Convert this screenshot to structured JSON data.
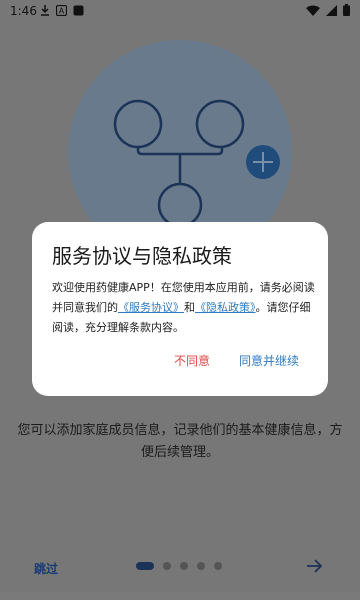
{
  "status": {
    "time": "1:46"
  },
  "onboarding": {
    "description": "您可以添加家庭成员信息，记录他们的基本健康信息，方便后续管理。",
    "skip_label": "跳过",
    "page_count": 5,
    "active_page": 1
  },
  "dialog": {
    "title": "服务协议与隐私政策",
    "body_prefix": "欢迎使用药健康APP！在您使用本应用前，请务必阅读并同意我们的",
    "service_link": "《服务协议》",
    "and_text": "和",
    "privacy_link": "《隐私政策》",
    "body_suffix": "。请您仔细阅读，充分理解条款内容。",
    "disagree_label": "不同意",
    "agree_label": "同意并继续"
  },
  "colors": {
    "overlay": "#777777",
    "circle": "#697a8c",
    "accent_blue": "#2f7cc1",
    "disagree_red": "#e04848",
    "navy": "#1b3356"
  }
}
